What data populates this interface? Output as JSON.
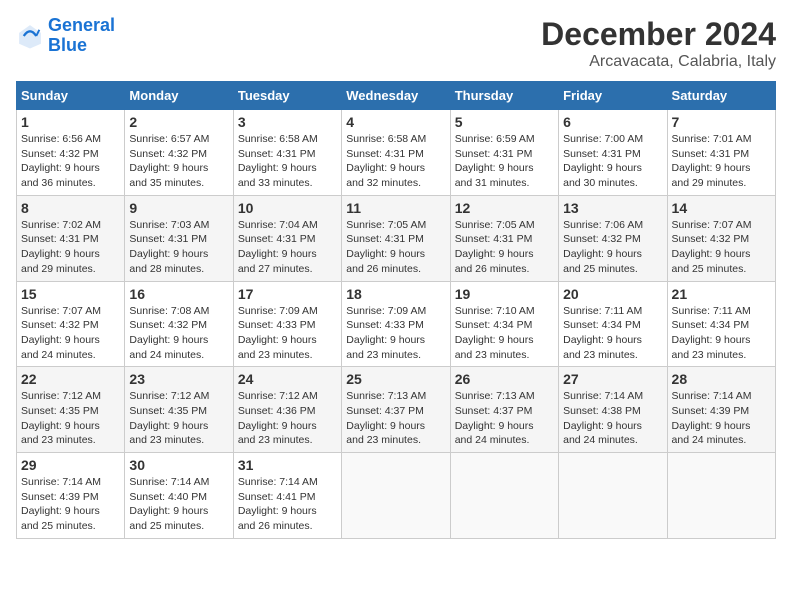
{
  "logo": {
    "line1": "General",
    "line2": "Blue"
  },
  "title": "December 2024",
  "subtitle": "Arcavacata, Calabria, Italy",
  "headers": [
    "Sunday",
    "Monday",
    "Tuesday",
    "Wednesday",
    "Thursday",
    "Friday",
    "Saturday"
  ],
  "weeks": [
    [
      {
        "day": "1",
        "info": "Sunrise: 6:56 AM\nSunset: 4:32 PM\nDaylight: 9 hours\nand 36 minutes."
      },
      {
        "day": "2",
        "info": "Sunrise: 6:57 AM\nSunset: 4:32 PM\nDaylight: 9 hours\nand 35 minutes."
      },
      {
        "day": "3",
        "info": "Sunrise: 6:58 AM\nSunset: 4:31 PM\nDaylight: 9 hours\nand 33 minutes."
      },
      {
        "day": "4",
        "info": "Sunrise: 6:58 AM\nSunset: 4:31 PM\nDaylight: 9 hours\nand 32 minutes."
      },
      {
        "day": "5",
        "info": "Sunrise: 6:59 AM\nSunset: 4:31 PM\nDaylight: 9 hours\nand 31 minutes."
      },
      {
        "day": "6",
        "info": "Sunrise: 7:00 AM\nSunset: 4:31 PM\nDaylight: 9 hours\nand 30 minutes."
      },
      {
        "day": "7",
        "info": "Sunrise: 7:01 AM\nSunset: 4:31 PM\nDaylight: 9 hours\nand 29 minutes."
      }
    ],
    [
      {
        "day": "8",
        "info": "Sunrise: 7:02 AM\nSunset: 4:31 PM\nDaylight: 9 hours\nand 29 minutes."
      },
      {
        "day": "9",
        "info": "Sunrise: 7:03 AM\nSunset: 4:31 PM\nDaylight: 9 hours\nand 28 minutes."
      },
      {
        "day": "10",
        "info": "Sunrise: 7:04 AM\nSunset: 4:31 PM\nDaylight: 9 hours\nand 27 minutes."
      },
      {
        "day": "11",
        "info": "Sunrise: 7:05 AM\nSunset: 4:31 PM\nDaylight: 9 hours\nand 26 minutes."
      },
      {
        "day": "12",
        "info": "Sunrise: 7:05 AM\nSunset: 4:31 PM\nDaylight: 9 hours\nand 26 minutes."
      },
      {
        "day": "13",
        "info": "Sunrise: 7:06 AM\nSunset: 4:32 PM\nDaylight: 9 hours\nand 25 minutes."
      },
      {
        "day": "14",
        "info": "Sunrise: 7:07 AM\nSunset: 4:32 PM\nDaylight: 9 hours\nand 25 minutes."
      }
    ],
    [
      {
        "day": "15",
        "info": "Sunrise: 7:07 AM\nSunset: 4:32 PM\nDaylight: 9 hours\nand 24 minutes."
      },
      {
        "day": "16",
        "info": "Sunrise: 7:08 AM\nSunset: 4:32 PM\nDaylight: 9 hours\nand 24 minutes."
      },
      {
        "day": "17",
        "info": "Sunrise: 7:09 AM\nSunset: 4:33 PM\nDaylight: 9 hours\nand 23 minutes."
      },
      {
        "day": "18",
        "info": "Sunrise: 7:09 AM\nSunset: 4:33 PM\nDaylight: 9 hours\nand 23 minutes."
      },
      {
        "day": "19",
        "info": "Sunrise: 7:10 AM\nSunset: 4:34 PM\nDaylight: 9 hours\nand 23 minutes."
      },
      {
        "day": "20",
        "info": "Sunrise: 7:11 AM\nSunset: 4:34 PM\nDaylight: 9 hours\nand 23 minutes."
      },
      {
        "day": "21",
        "info": "Sunrise: 7:11 AM\nSunset: 4:34 PM\nDaylight: 9 hours\nand 23 minutes."
      }
    ],
    [
      {
        "day": "22",
        "info": "Sunrise: 7:12 AM\nSunset: 4:35 PM\nDaylight: 9 hours\nand 23 minutes."
      },
      {
        "day": "23",
        "info": "Sunrise: 7:12 AM\nSunset: 4:35 PM\nDaylight: 9 hours\nand 23 minutes."
      },
      {
        "day": "24",
        "info": "Sunrise: 7:12 AM\nSunset: 4:36 PM\nDaylight: 9 hours\nand 23 minutes."
      },
      {
        "day": "25",
        "info": "Sunrise: 7:13 AM\nSunset: 4:37 PM\nDaylight: 9 hours\nand 23 minutes."
      },
      {
        "day": "26",
        "info": "Sunrise: 7:13 AM\nSunset: 4:37 PM\nDaylight: 9 hours\nand 24 minutes."
      },
      {
        "day": "27",
        "info": "Sunrise: 7:14 AM\nSunset: 4:38 PM\nDaylight: 9 hours\nand 24 minutes."
      },
      {
        "day": "28",
        "info": "Sunrise: 7:14 AM\nSunset: 4:39 PM\nDaylight: 9 hours\nand 24 minutes."
      }
    ],
    [
      {
        "day": "29",
        "info": "Sunrise: 7:14 AM\nSunset: 4:39 PM\nDaylight: 9 hours\nand 25 minutes."
      },
      {
        "day": "30",
        "info": "Sunrise: 7:14 AM\nSunset: 4:40 PM\nDaylight: 9 hours\nand 25 minutes."
      },
      {
        "day": "31",
        "info": "Sunrise: 7:14 AM\nSunset: 4:41 PM\nDaylight: 9 hours\nand 26 minutes."
      },
      null,
      null,
      null,
      null
    ]
  ]
}
